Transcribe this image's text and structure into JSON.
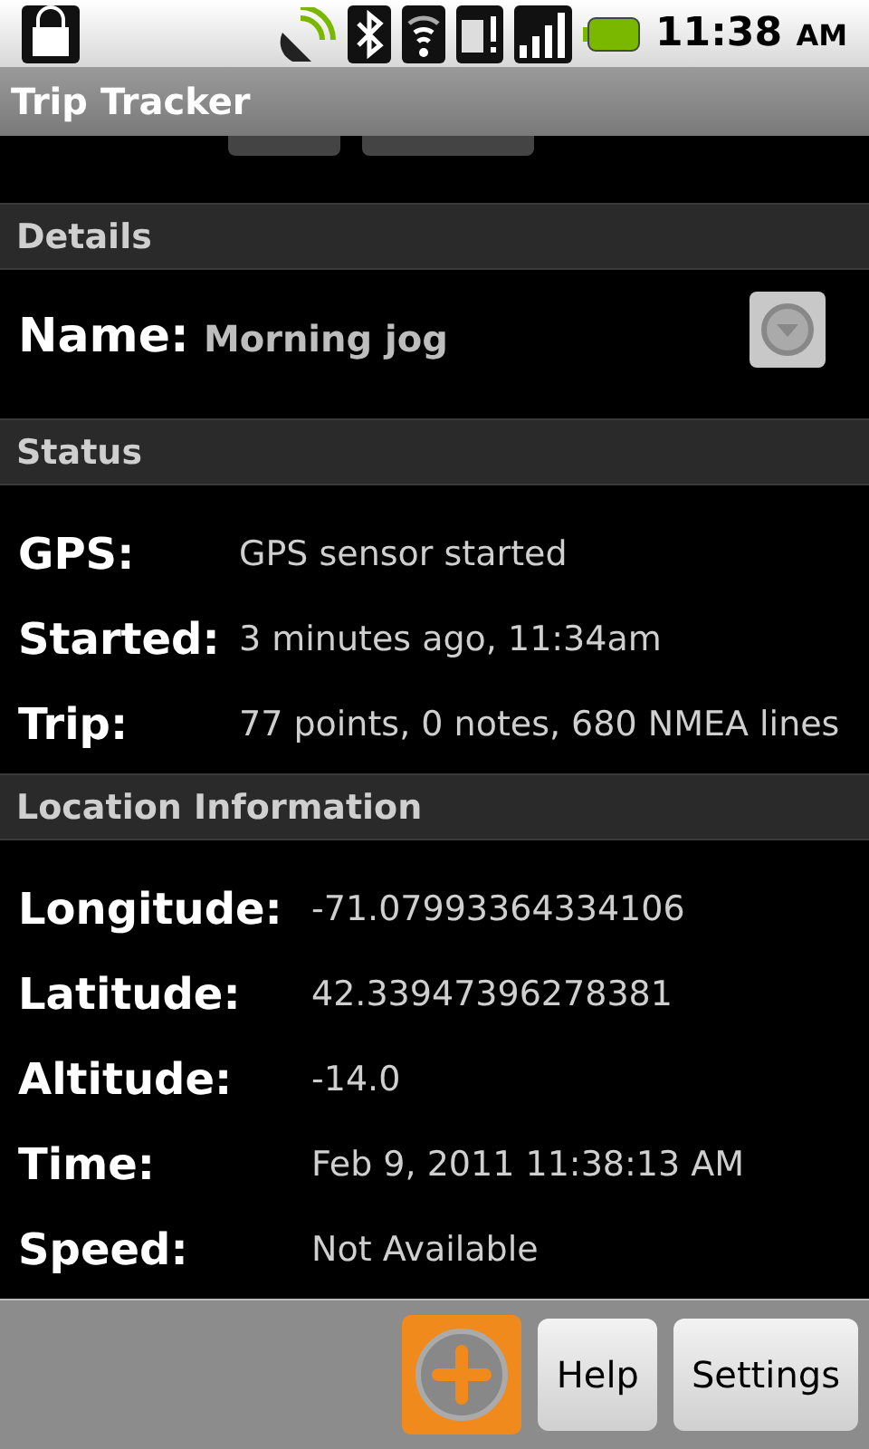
{
  "status_bar": {
    "time": "11:38",
    "meridiem": "AM"
  },
  "title_bar": {
    "title": "Trip Tracker"
  },
  "sections": [
    {
      "header": "Details",
      "kind": "name",
      "label": "Name:",
      "value": "Morning jog"
    },
    {
      "header": "Status",
      "kind": "fields",
      "rows": [
        {
          "label": "GPS:",
          "value": "GPS sensor started"
        },
        {
          "label": "Started:",
          "value": "3 minutes ago, 11:34am"
        },
        {
          "label": "Trip:",
          "value": "77 points, 0 notes, 680 NMEA lines"
        }
      ]
    },
    {
      "header": "Location Information",
      "kind": "wide_fields",
      "rows": [
        {
          "label": "Longitude:",
          "value": "-71.07993364334106"
        },
        {
          "label": "Latitude:",
          "value": "42.33947396278381"
        },
        {
          "label": "Altitude:",
          "value": "-14.0"
        },
        {
          "label": "Time:",
          "value": "Feb 9, 2011 11:38:13 AM"
        },
        {
          "label": "Speed:",
          "value": "Not Available"
        }
      ]
    }
  ],
  "bottom_bar": {
    "buttons": [
      "Help",
      "Settings"
    ]
  }
}
